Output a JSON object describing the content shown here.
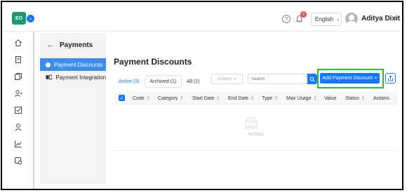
{
  "header": {
    "logo_text": "EO",
    "notification_count": "5",
    "language": "English",
    "user_name": "Aditya Dixit"
  },
  "rail": {
    "icons": [
      "home-icon",
      "receipt-icon",
      "copy-icon",
      "user-add-icon",
      "checkbox-icon",
      "user-icon",
      "chart-icon",
      "settings-icon"
    ]
  },
  "subnav": {
    "title": "Payments",
    "items": [
      {
        "label": "Payment Discounts",
        "active": true
      },
      {
        "label": "Payment Integration",
        "active": false
      }
    ]
  },
  "main": {
    "title": "Payment Discounts",
    "tabs": [
      {
        "label": "Active (0)"
      },
      {
        "label": "Archived (1)"
      },
      {
        "label": "All (1)"
      }
    ],
    "actions_label": "Actions",
    "search_placeholder": "Search",
    "add_button_label": "Add Payment Discount",
    "columns": [
      "Code",
      "Category",
      "Start Date",
      "End Date",
      "Type",
      "Max Usage",
      "Value",
      "Status",
      "Actions"
    ],
    "empty_text": "No Data"
  },
  "colors": {
    "primary": "#1677ff",
    "logo": "#1a9a73",
    "highlight": "#30c030",
    "badge": "#e5484d"
  }
}
